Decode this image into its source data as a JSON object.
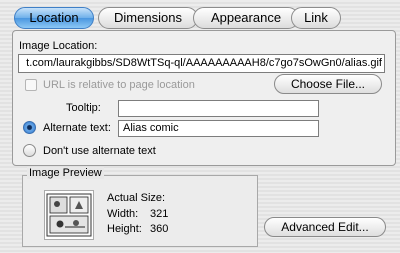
{
  "tabs": [
    {
      "label": "Location",
      "active": true
    },
    {
      "label": "Dimensions",
      "active": false
    },
    {
      "label": "Appearance",
      "active": false
    },
    {
      "label": "Link",
      "active": false
    }
  ],
  "location": {
    "section_label": "Image Location:",
    "url_value": "t.com/laurakgibbs/SD8WtTSq-ql/AAAAAAAAAH8/c7go7sOwGn0/alias.gif",
    "relative_label": "URL is relative to page location",
    "relative_checked": false,
    "relative_enabled": false,
    "choose_file_label": "Choose File..."
  },
  "tooltip": {
    "label": "Tooltip:",
    "value": ""
  },
  "alt": {
    "alternate_label": "Alternate text:",
    "alternate_value": "Alias comic",
    "alternate_selected": true,
    "dont_use_label": "Don't use alternate text",
    "dont_use_selected": false
  },
  "preview": {
    "title": "Image Preview",
    "actual_size_label": "Actual Size:",
    "width_label": "Width:",
    "width_value": "321",
    "height_label": "Height:",
    "height_value": "360"
  },
  "advanced_edit_label": "Advanced Edit...",
  "colors": {
    "tab_active": "#4a96e0",
    "radio_selected": "#3f86d6"
  },
  "icons": {
    "thumbnail": "comic-thumbnail"
  }
}
